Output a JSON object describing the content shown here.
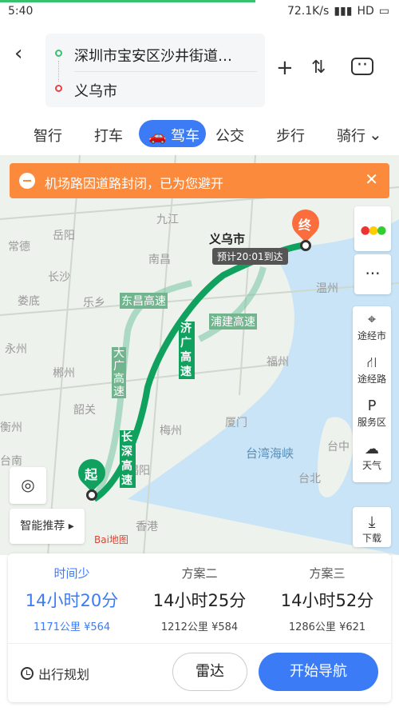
{
  "status_bar": {
    "time": "5:40",
    "network": "72.1K/s",
    "signal": "HD",
    "battery_icon": "battery-icon"
  },
  "header": {
    "start": "深圳市宝安区沙井街道…",
    "end": "义乌市"
  },
  "modes": [
    "智行",
    "打车",
    "驾车",
    "公交",
    "步行",
    "骑行"
  ],
  "active_mode": "驾车",
  "alert": {
    "text": "机场路因道路封闭，已为您避开"
  },
  "map": {
    "destination_label": "义乌市",
    "eta": "预计20:01到达",
    "end_marker": "终",
    "start_marker": "起",
    "cities": [
      "九江",
      "岳阳",
      "常德",
      "南昌",
      "长沙",
      "娄底",
      "乐乡",
      "永州",
      "郴州",
      "韶关",
      "梅州",
      "揭阳",
      "厦门",
      "福州",
      "温州",
      "台北",
      "台中",
      "台南",
      "香港",
      "衡州"
    ],
    "road_labels": [
      "东昌高速",
      "大广高速",
      "济广高速",
      "长深高速",
      "浦建高速"
    ],
    "strait": "台湾海峡",
    "logo": "Bai地图"
  },
  "controls": {
    "smart_recommend": "智能推荐",
    "right_buttons": [
      "途经市",
      "途经路",
      "服务区",
      "天气"
    ],
    "download": "下载"
  },
  "routes": [
    {
      "label": "时间少",
      "time": "14小时20分",
      "distance": "1171公里",
      "cost": "¥564"
    },
    {
      "label": "方案二",
      "time": "14小时25分",
      "distance": "1212公里",
      "cost": "¥584"
    },
    {
      "label": "方案三",
      "time": "14小时52分",
      "distance": "1286公里",
      "cost": "¥621"
    }
  ],
  "bottom": {
    "plan": "出行规划",
    "radar": "雷达",
    "navigate": "开始导航"
  }
}
